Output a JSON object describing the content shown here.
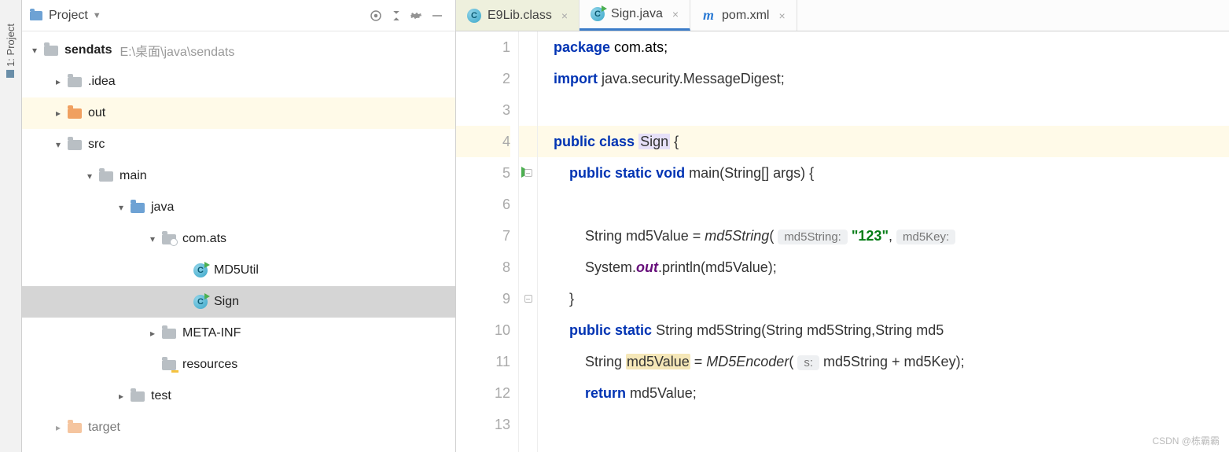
{
  "sideStrip": {
    "label": "1: Project"
  },
  "projectHeader": {
    "title": "Project"
  },
  "tree": {
    "root": {
      "name": "sendats",
      "path": "E:\\桌面\\java\\sendats"
    },
    "idea": ".idea",
    "out": "out",
    "src": "src",
    "main": "main",
    "java": "java",
    "pkg": "com.ats",
    "md5util": "MD5Util",
    "sign": "Sign",
    "metainf": "META-INF",
    "resources": "resources",
    "test": "test",
    "target": "target"
  },
  "tabs": [
    {
      "label": "E9Lib.class",
      "kind": "class-locked",
      "active": false,
      "shaded": true
    },
    {
      "label": "Sign.java",
      "kind": "class-run",
      "active": true,
      "shaded": false
    },
    {
      "label": "pom.xml",
      "kind": "maven",
      "active": false,
      "shaded": false
    }
  ],
  "code": {
    "lines": [
      "1",
      "2",
      "3",
      "4",
      "5",
      "6",
      "7",
      "8",
      "9",
      "10",
      "11",
      "12",
      "13"
    ],
    "l1_kw": "package",
    "l1_rest": " com.ats;",
    "l2_kw": "import",
    "l2_rest": " java.security.MessageDigest;",
    "l4_kw1": "public",
    "l4_kw2": "class",
    "l4_name": "Sign",
    "l4_brace": " {",
    "l5_kw1": "public",
    "l5_kw2": "static",
    "l5_kw3": "void",
    "l5_rest": " main(String[] args) {",
    "l7_a": "        String md5Value = ",
    "l7_fn": "md5String",
    "l7_b": "( ",
    "l7_hint1": "md5String:",
    "l7_str": "\"123\"",
    "l7_comma": ", ",
    "l7_hint2": "md5Key:",
    "l8_a": "        System.",
    "l8_out": "out",
    "l8_b": ".println(md5Value);",
    "l9": "    }",
    "l10_kw1": "public",
    "l10_kw2": "static",
    "l10_rest": " String md5String(String md5String,String md5",
    "l11_a": "        String ",
    "l11_hl": "md5Value",
    "l11_b": " = ",
    "l11_fn": "MD5Encoder",
    "l11_c": "( ",
    "l11_hint": "s:",
    "l11_d": " md5String + md5Key);",
    "l12_kw": "return",
    "l12_rest": " md5Value;"
  },
  "watermark": "CSDN @栋霸霸"
}
